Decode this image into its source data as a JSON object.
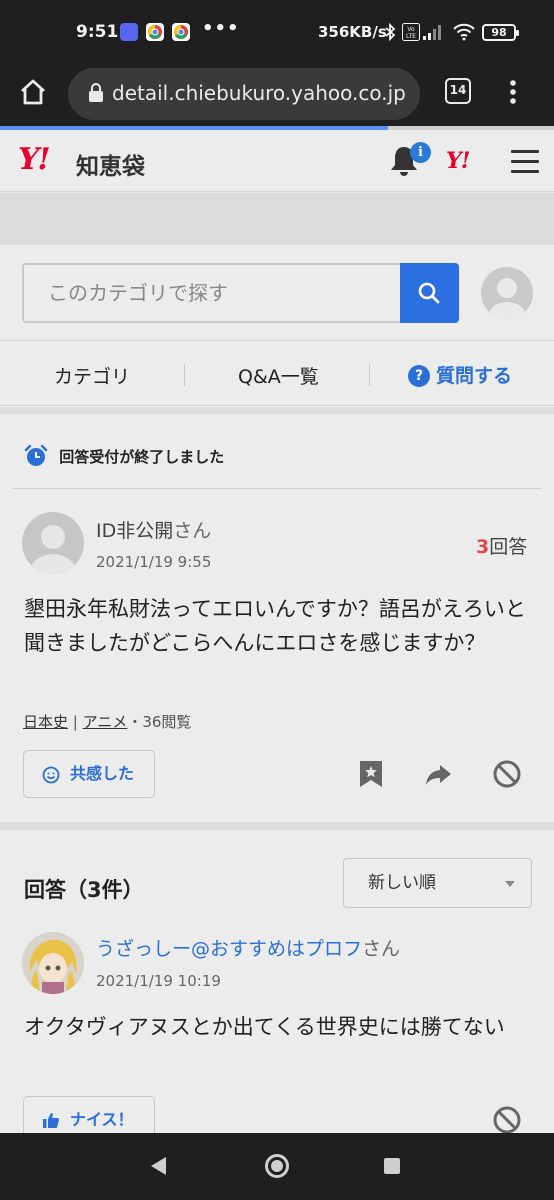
{
  "status_bar": {
    "time": "9:51",
    "notification_icons": [
      "discord-icon",
      "chrome-icon",
      "chrome-icon"
    ],
    "more": "•••",
    "network_speed": "356KB/s",
    "battery_level": "98"
  },
  "browser": {
    "url": "detail.chiebukuro.yahoo.co.jp",
    "tab_count": "14",
    "load_progress": 0.7
  },
  "site_header": {
    "logo_mark": "Y!",
    "logo_text": "知恵袋",
    "notification_badge": "i",
    "yahoo_mark": "Y!"
  },
  "search": {
    "placeholder": "このカテゴリで探す"
  },
  "nav": {
    "category": "カテゴリ",
    "qa_list": "Q&A一覧",
    "ask_icon": "?",
    "ask": "質問する"
  },
  "question": {
    "status": "回答受付が終了しました",
    "user": "ID非公開",
    "honorific": "さん",
    "date": "2021/1/19 9:55",
    "answer_count": "3",
    "answer_label": "回答",
    "body": "墾田永年私財法ってエロいんですか？語呂がえろいと聞きましたがどこらへんにエロさを感じますか？",
    "tags": [
      "日本史",
      "アニメ"
    ],
    "tag_separator": " | ",
    "views": "・36閲覧",
    "empathy_label": "共感した"
  },
  "answers": {
    "title": "回答（3件）",
    "sort_selected": "新しい順",
    "items": [
      {
        "user": "うざっしー@おすすめはプロフ",
        "honorific": "さん",
        "date": "2021/1/19 10:19",
        "body": "オクタヴィアヌスとか出てくる世界史には勝てない",
        "nice_label": "ナイス！"
      }
    ]
  },
  "colors": {
    "yahoo_red": "#e8002d",
    "link_blue": "#2a6fd6",
    "search_button": "#2c6fe0",
    "answer_count_red": "#e0484b"
  }
}
